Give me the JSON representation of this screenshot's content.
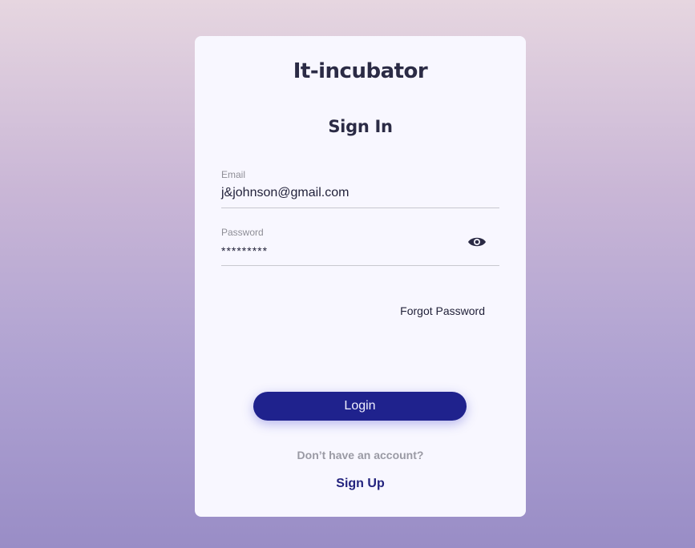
{
  "app": {
    "title": "It-incubator"
  },
  "form": {
    "heading": "Sign In",
    "email": {
      "label": "Email",
      "value": "j&johnson@gmail.com"
    },
    "password": {
      "label": "Password",
      "value": "*********",
      "toggle_icon": "eye-icon"
    },
    "forgot_label": "Forgot Password",
    "login_label": "Login",
    "no_account_text": "Don’t have an account?",
    "signup_label": "Sign Up"
  },
  "colors": {
    "accent": "#1f228d",
    "link": "#23237e"
  }
}
